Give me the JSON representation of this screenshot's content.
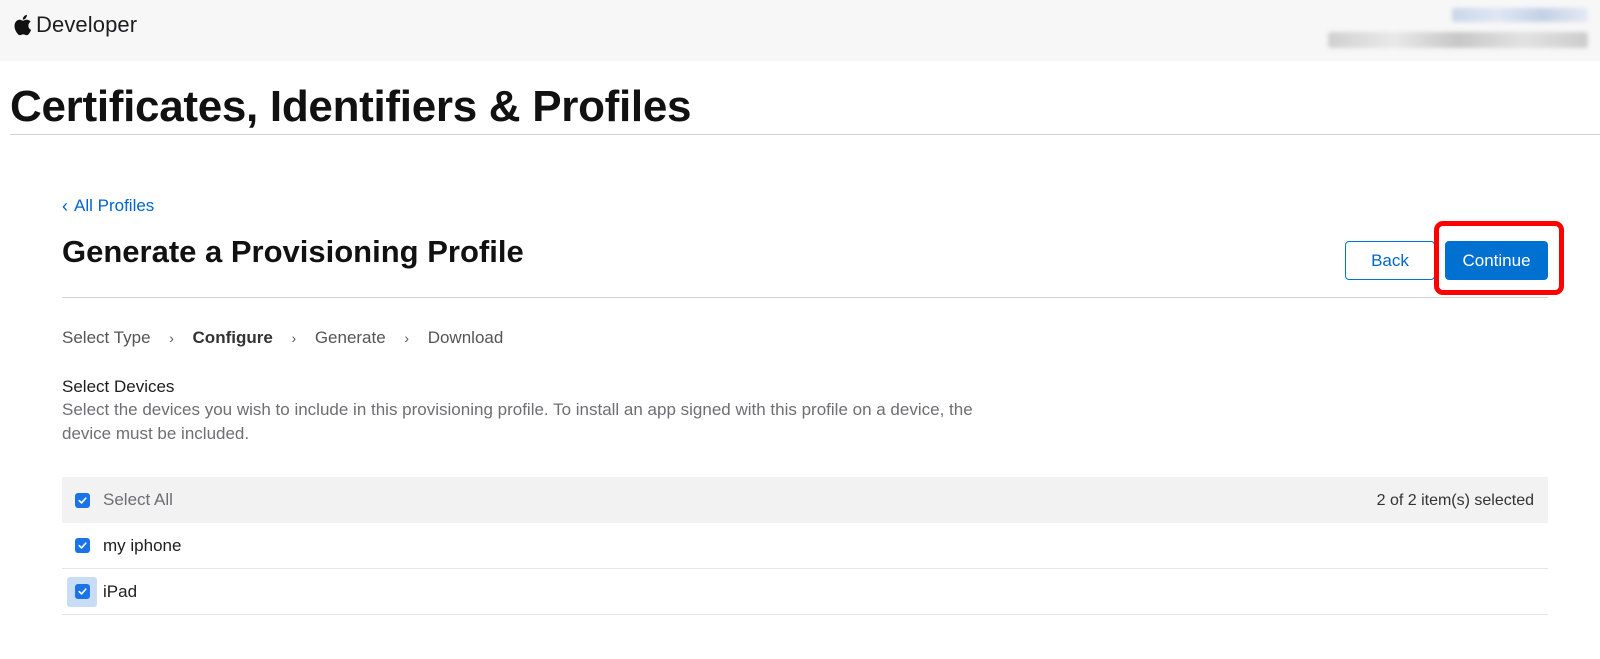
{
  "header": {
    "brand": "Developer",
    "apple_icon": "apple-logo-icon"
  },
  "page": {
    "title": "Certificates, Identifiers & Profiles"
  },
  "breadcrumb": {
    "back_label": "All Profiles"
  },
  "section": {
    "title": "Generate a Provisioning Profile",
    "back_button": "Back",
    "continue_button": "Continue",
    "accent_color": "#0071d0",
    "highlight_color": "#ff0000"
  },
  "steps": [
    {
      "label": "Select Type",
      "active": false
    },
    {
      "label": "Configure",
      "active": true
    },
    {
      "label": "Generate",
      "active": false
    },
    {
      "label": "Download",
      "active": false
    }
  ],
  "devices": {
    "label": "Select Devices",
    "description": "Select the devices you wish to include in this provisioning profile. To install an app signed with this profile on a device, the device must be included.",
    "select_all": "Select All",
    "selected_count": "2 of 2 item(s) selected",
    "rows": [
      {
        "name": "my iphone",
        "checked": true
      },
      {
        "name": "iPad",
        "checked": true
      }
    ]
  }
}
